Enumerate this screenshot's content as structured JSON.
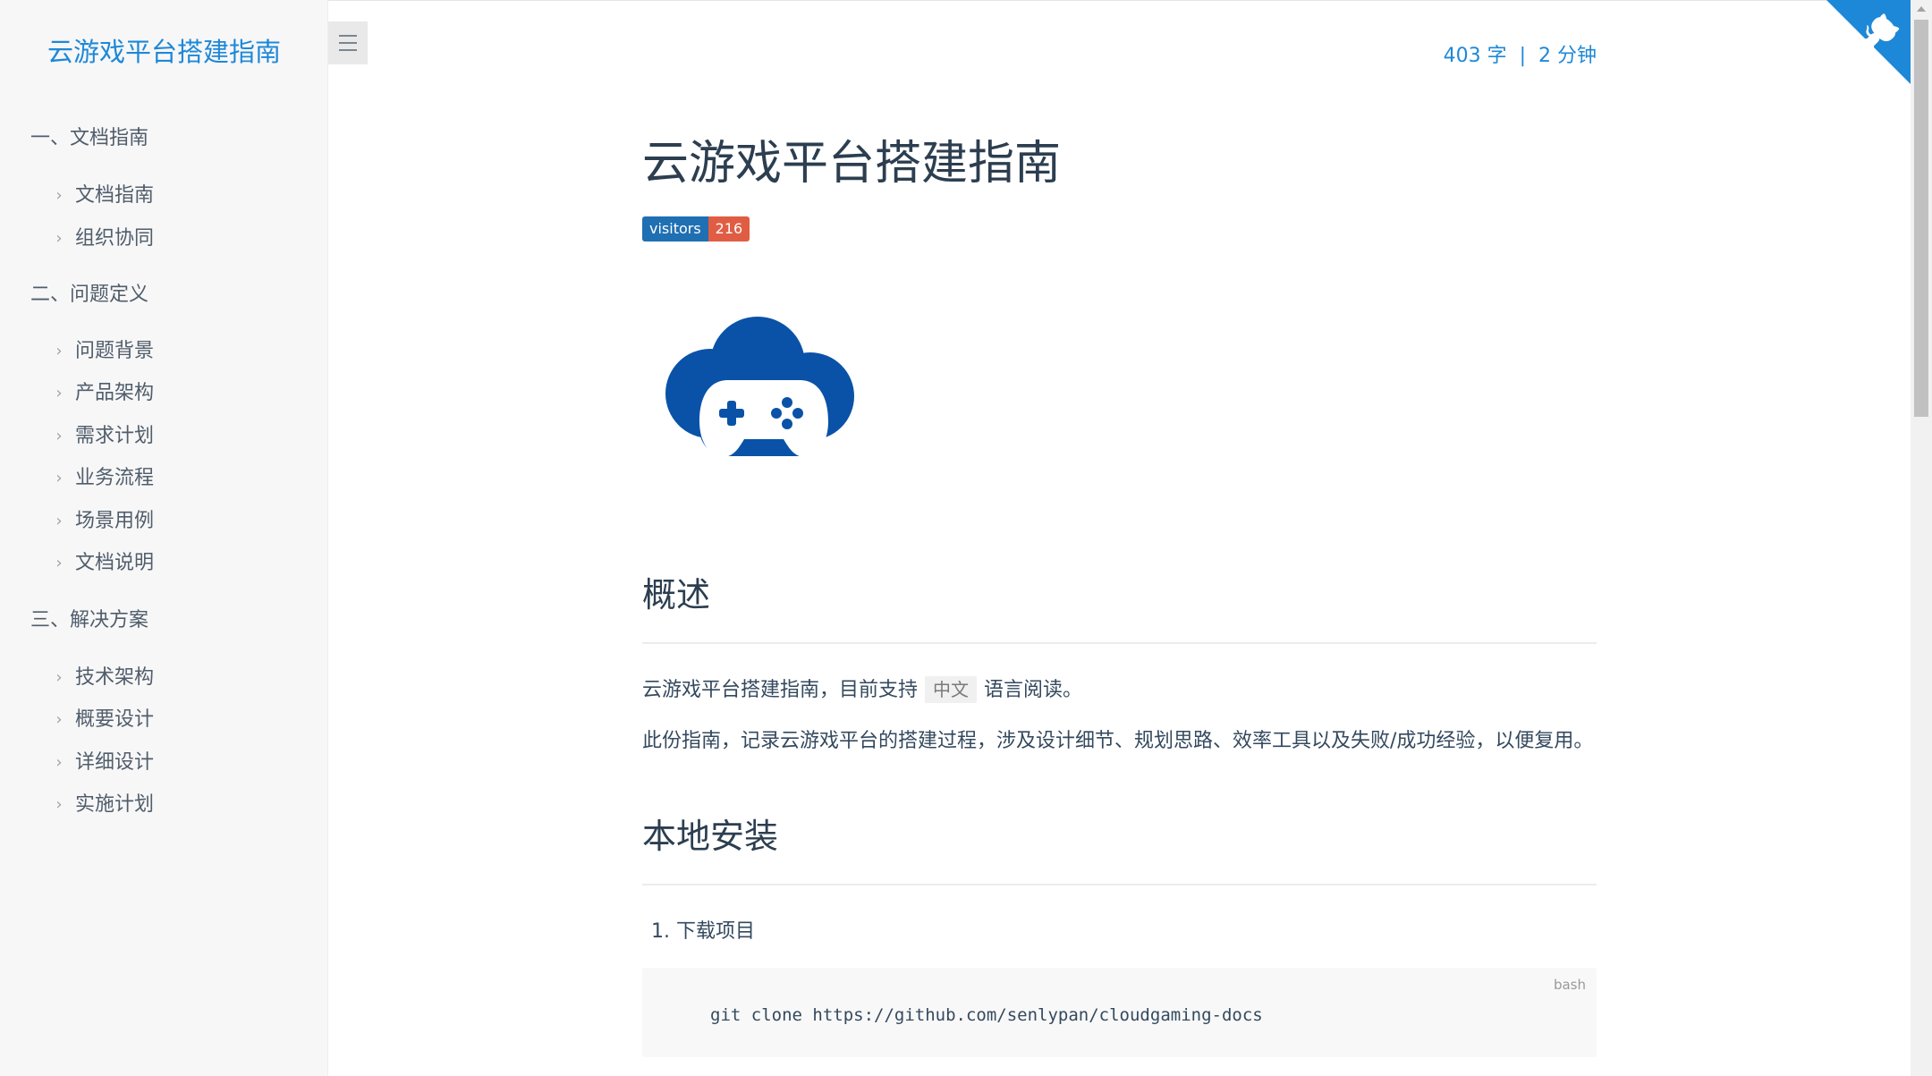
{
  "sidebar": {
    "app_name": "云游戏平台搭建指南",
    "sections": [
      {
        "title": "一、文档指南",
        "items": [
          "文档指南",
          "组织协同"
        ]
      },
      {
        "title": "二、问题定义",
        "items": [
          "问题背景",
          "产品架构",
          "需求计划",
          "业务流程",
          "场景用例",
          "文档说明"
        ]
      },
      {
        "title": "三、解决方案",
        "items": [
          "技术架构",
          "概要设计",
          "详细设计",
          "实施计划"
        ]
      }
    ]
  },
  "meta": {
    "word_count": "403 字",
    "separator": "|",
    "read_time": "2 分钟"
  },
  "main": {
    "title": "云游戏平台搭建指南",
    "badge": {
      "label": "visitors",
      "value": "216"
    },
    "overview": {
      "heading": "概述",
      "p1_before": "云游戏平台搭建指南，目前支持",
      "p1_code": "中文",
      "p1_after": "语言阅读。",
      "p2": "此份指南，记录云游戏平台的搭建过程，涉及设计细节、规划思路、效率工具以及失败/成功经验，以便复用。"
    },
    "install": {
      "heading": "本地安装",
      "step1": "1. 下载项目",
      "code_lang": "bash",
      "code": "git clone https://github.com/senlypan/cloudgaming-docs"
    }
  },
  "colors": {
    "accent": "#1e88d8",
    "logo_blue": "#0a52a8",
    "badge_label_bg": "#1f6fb3",
    "badge_value_bg": "#e05d44"
  },
  "icons": {
    "toggle": "hamburger-icon",
    "chevron": "chevron-right-icon",
    "corner": "github-octocat-icon",
    "logo": "cloud-gamepad-logo"
  }
}
